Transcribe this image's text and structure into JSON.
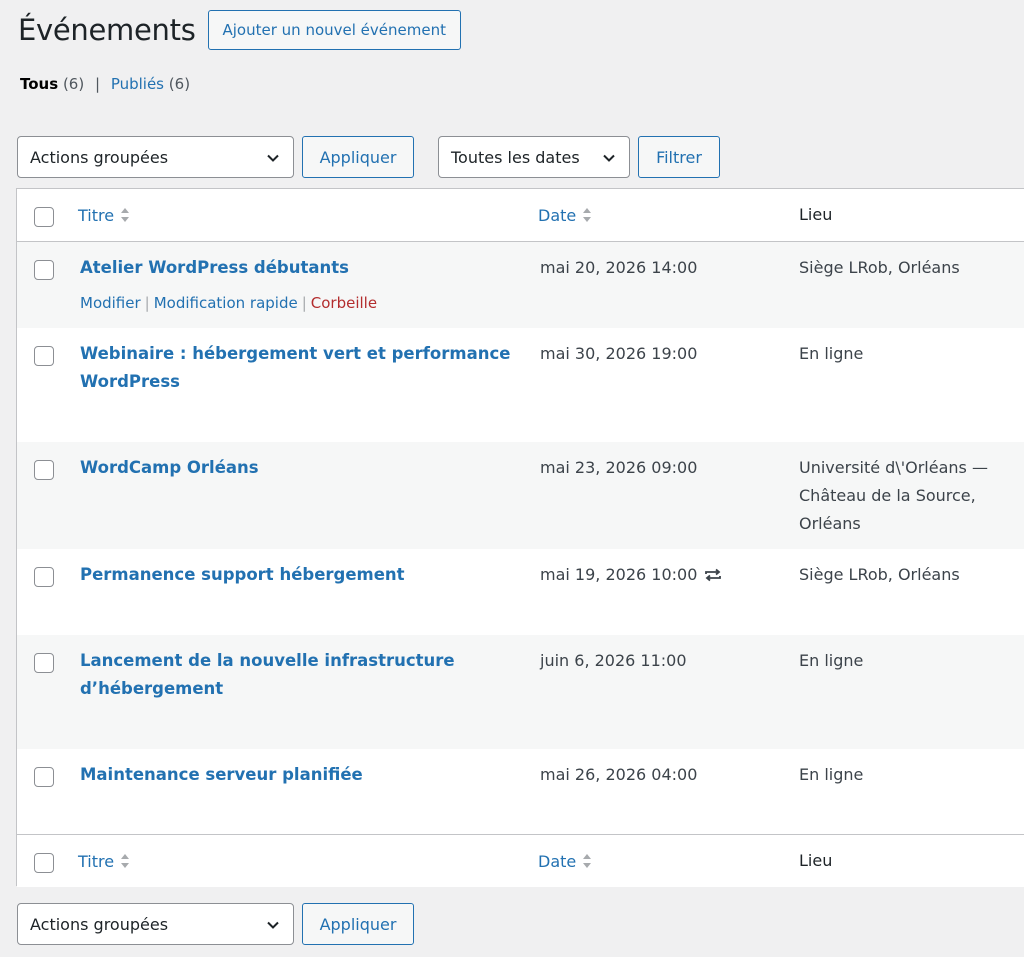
{
  "header": {
    "title": "Événements",
    "add_button": "Ajouter un nouvel événement"
  },
  "views": {
    "all_label": "Tous",
    "all_count": "(6)",
    "separator": "|",
    "published_label": "Publiés",
    "published_count": "(6)"
  },
  "top_controls": {
    "bulk_select_value": "Actions groupées",
    "apply_label": "Appliquer",
    "date_select_value": "Toutes les dates",
    "filter_label": "Filtrer"
  },
  "bottom_controls": {
    "bulk_select_value": "Actions groupées",
    "apply_label": "Appliquer"
  },
  "table": {
    "columns": {
      "title": "Titre",
      "date": "Date",
      "lieu": "Lieu"
    },
    "rows": [
      {
        "title": "Atelier WordPress débutants",
        "date": "mai 20, 2026 14:00",
        "lieu": "Siège LRob, Orléans",
        "recurring": false
      },
      {
        "title": "Webinaire : hébergement vert et performance WordPress",
        "date": "mai 30, 2026 19:00",
        "lieu": "En ligne",
        "recurring": false
      },
      {
        "title": "WordCamp Orléans",
        "date": "mai 23, 2026 09:00",
        "lieu": "Université d\\'Orléans — Château de la Source, Orléans",
        "recurring": false
      },
      {
        "title": "Permanence support hébergement",
        "date": "mai 19, 2026 10:00",
        "lieu": "Siège LRob, Orléans",
        "recurring": true
      },
      {
        "title": "Lancement de la nouvelle infrastructure d’hébergement",
        "date": "juin 6, 2026 11:00",
        "lieu": "En ligne",
        "recurring": false
      },
      {
        "title": "Maintenance serveur planifiée",
        "date": "mai 26, 2026 04:00",
        "lieu": "En ligne",
        "recurring": false
      }
    ],
    "row_actions": {
      "edit": "Modifier",
      "quick_edit": "Modification rapide",
      "trash": "Corbeille",
      "separator": "|"
    }
  },
  "colors": {
    "link": "#2271b1",
    "trash": "#b32d2e",
    "background": "#f0f0f1",
    "border": "#c3c4c7"
  },
  "icons": [
    "sort-icon",
    "chevron-down-icon",
    "repeat-icon"
  ]
}
